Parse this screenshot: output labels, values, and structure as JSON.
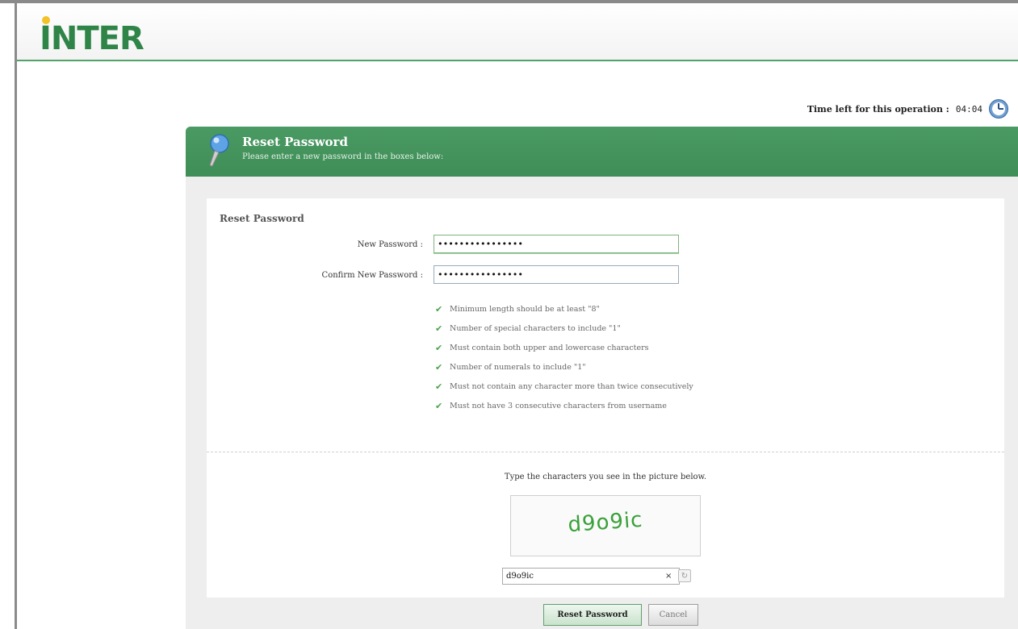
{
  "header": {
    "logo_text": "INTER"
  },
  "timer": {
    "label": "Time left for this operation :",
    "value": "04:04",
    "icon": "clock-icon"
  },
  "banner": {
    "title": "Reset Password",
    "subtitle": "Please enter a new password in the boxes below:",
    "icon": "pushpin-icon"
  },
  "form": {
    "section_title": "Reset Password",
    "new_password": {
      "label": "New Password :",
      "value": "••••••••••••••••"
    },
    "confirm_password": {
      "label": "Confirm New Password :",
      "value": "••••••••••••••••"
    },
    "rules": [
      "Minimum length should be at least \"8\"",
      "Number of special characters to include \"1\"",
      "Must contain both upper and lowercase characters",
      "Number of numerals to include \"1\"",
      "Must not contain any character more than twice consecutively",
      "Must not have 3 consecutive characters from username"
    ]
  },
  "captcha": {
    "prompt": "Type the characters you see in the picture below.",
    "image_text": "d9o9ic",
    "input_value": "d9o9ic",
    "clear_label": "×"
  },
  "buttons": {
    "reset": "Reset Password",
    "cancel": "Cancel"
  },
  "colors": {
    "brand_green": "#3f8d57",
    "check_green": "#4aa34a"
  }
}
